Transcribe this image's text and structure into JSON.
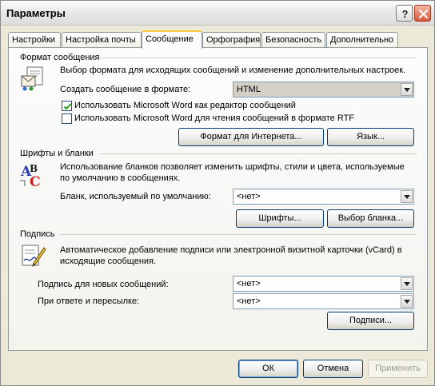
{
  "window": {
    "title": "Параметры",
    "help_label": "?",
    "close_label": "✕"
  },
  "tabs": [
    {
      "label": "Настройки",
      "active": false
    },
    {
      "label": "Настройка почты",
      "active": false
    },
    {
      "label": "Сообщение",
      "active": true
    },
    {
      "label": "Орфография",
      "active": false
    },
    {
      "label": "Безопасность",
      "active": false
    },
    {
      "label": "Дополнительно",
      "active": false
    }
  ],
  "message_format": {
    "heading": "Формат сообщения",
    "description": "Выбор формата для исходящих сообщений и изменение дополнительных настроек.",
    "compose_label": "Создать сообщение в формате:",
    "compose_value": "HTML",
    "use_word_editor": {
      "label": "Использовать Microsoft Word как редактор сообщений",
      "checked": true
    },
    "use_word_rtf": {
      "label": "Использовать Microsoft Word для чтения сообщений в формате RTF",
      "checked": false
    },
    "internet_format_button": "Формат для Интернета...",
    "language_button": "Язык..."
  },
  "stationery": {
    "heading": "Шрифты и бланки",
    "description": "Использование бланков позволяет изменить шрифты, стили и цвета, используемые по умолчанию в сообщениях.",
    "default_label": "Бланк, используемый по умолчанию:",
    "default_value": "<нет>",
    "fonts_button": "Шрифты...",
    "choose_button": "Выбор бланка..."
  },
  "signature": {
    "heading": "Подпись",
    "description": "Автоматическое добавление подписи или электронной визитной карточки (vCard) в исходящие сообщения.",
    "new_label": "Подпись для новых сообщений:",
    "new_value": "<нет>",
    "reply_label": "При ответе и пересылке:",
    "reply_value": "<нет>",
    "signatures_button": "Подписи..."
  },
  "footer": {
    "ok": "ОК",
    "cancel": "Отмена",
    "apply": "Применить"
  }
}
